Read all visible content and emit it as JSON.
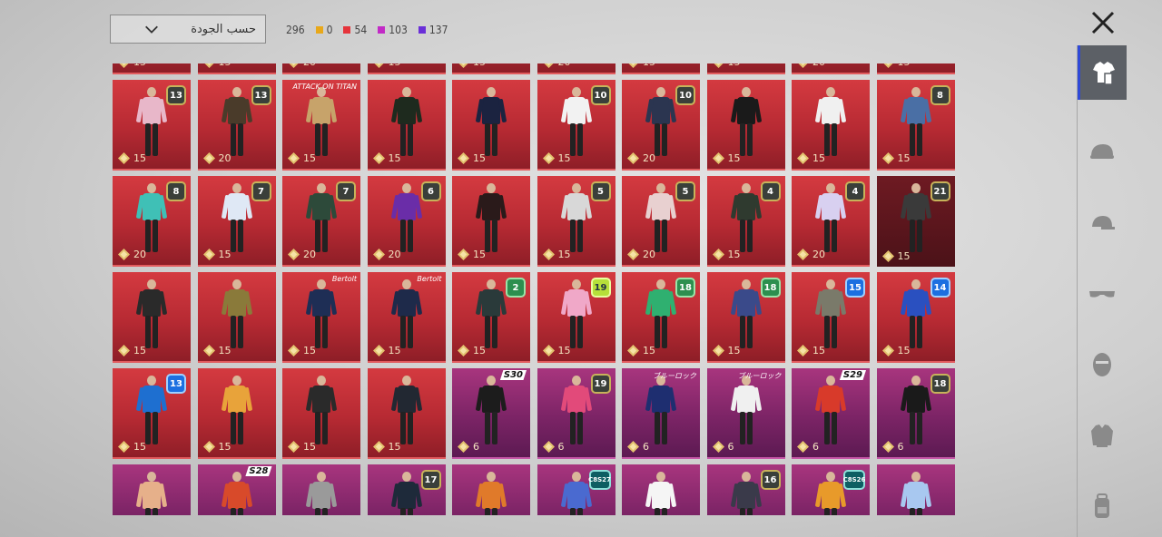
{
  "sort": {
    "label": "حسب الجودة"
  },
  "counts": {
    "total": "296",
    "items": [
      {
        "value": "0",
        "color": "#e8a81a"
      },
      {
        "value": "54",
        "color": "#e5343b"
      },
      {
        "value": "103",
        "color": "#c22ac6"
      },
      {
        "value": "137",
        "color": "#6a2fd8"
      }
    ]
  },
  "sidebar": {
    "items": [
      {
        "name": "outfit",
        "icon": "outfit-icon",
        "active": true
      },
      {
        "name": "helmet",
        "icon": "helmet-icon"
      },
      {
        "name": "hat",
        "icon": "cap-icon"
      },
      {
        "name": "glasses",
        "icon": "glasses-icon"
      },
      {
        "name": "mask",
        "icon": "mask-icon"
      },
      {
        "name": "jacket",
        "icon": "jacket-icon"
      },
      {
        "name": "backpack",
        "icon": "backpack-icon"
      }
    ]
  },
  "cards": [
    {
      "style": "red",
      "price": "15"
    },
    {
      "style": "red",
      "price": "15"
    },
    {
      "style": "red",
      "price": "20"
    },
    {
      "style": "red",
      "price": "15"
    },
    {
      "style": "red",
      "price": "15"
    },
    {
      "style": "red",
      "price": "20"
    },
    {
      "style": "red",
      "price": "15"
    },
    {
      "style": "red",
      "price": "15"
    },
    {
      "style": "red",
      "price": "20"
    },
    {
      "style": "red",
      "price": "15"
    },
    {
      "style": "red",
      "price": "15",
      "badge": "13",
      "fig": "#e8b7c9"
    },
    {
      "style": "red",
      "price": "20",
      "badge": "13",
      "fig": "#4a3b2a"
    },
    {
      "style": "red",
      "price": "15",
      "fig": "#c7a36a",
      "tag": "ATTACK ON TITAN"
    },
    {
      "style": "red",
      "price": "15",
      "fig": "#1e2a1e"
    },
    {
      "style": "red",
      "price": "15",
      "fig": "#1b2340"
    },
    {
      "style": "red",
      "price": "15",
      "badge": "10",
      "fig": "#f2f2f2"
    },
    {
      "style": "red",
      "price": "20",
      "badge": "10",
      "fig": "#2b3550"
    },
    {
      "style": "red",
      "price": "15",
      "fig": "#1a1a1a"
    },
    {
      "style": "red",
      "price": "15",
      "fig": "#f0f0f0"
    },
    {
      "style": "red",
      "price": "15",
      "badge": "8",
      "fig": "#4a6fa5"
    },
    {
      "style": "red",
      "price": "20",
      "badge": "8",
      "fig": "#3fc0b6"
    },
    {
      "style": "red",
      "price": "15",
      "badge": "7",
      "fig": "#dfe8f5"
    },
    {
      "style": "red",
      "price": "20",
      "badge": "7",
      "fig": "#2d4a3a"
    },
    {
      "style": "red",
      "price": "20",
      "badge": "6",
      "fig": "#6a2da8"
    },
    {
      "style": "red",
      "price": "15",
      "fig": "#2a1a1a"
    },
    {
      "style": "red",
      "price": "15",
      "badge": "5",
      "fig": "#d8d8d8"
    },
    {
      "style": "red",
      "price": "20",
      "badge": "5",
      "fig": "#e8d0d0"
    },
    {
      "style": "red",
      "price": "15",
      "badge": "4",
      "fig": "#2f3a2f"
    },
    {
      "style": "red",
      "price": "20",
      "badge": "4",
      "fig": "#d8d0f0"
    },
    {
      "style": "dark",
      "price": "15",
      "badge": "21",
      "fig": "#3a3a3a"
    },
    {
      "style": "red",
      "price": "15",
      "fig": "#2a2a2a"
    },
    {
      "style": "red",
      "price": "15",
      "fig": "#8a7a3a"
    },
    {
      "style": "red",
      "price": "15",
      "fig": "#1e2e55",
      "tag": "Bertolt"
    },
    {
      "style": "red",
      "price": "15",
      "fig": "#1e2a4a",
      "tag": "Bertolt"
    },
    {
      "style": "red",
      "price": "15",
      "badge": "2",
      "badgeStyle": "green",
      "fig": "#2a3a3a"
    },
    {
      "style": "red",
      "price": "15",
      "badge": "19",
      "badgeStyle": "lime",
      "fig": "#f0a8c8"
    },
    {
      "style": "red",
      "price": "15",
      "badge": "18",
      "badgeStyle": "green",
      "fig": "#2fb070"
    },
    {
      "style": "red",
      "price": "15",
      "badge": "18",
      "badgeStyle": "green",
      "fig": "#3a4a8a"
    },
    {
      "style": "red",
      "price": "15",
      "badge": "15",
      "badgeStyle": "blue",
      "fig": "#7a7a6a"
    },
    {
      "style": "red",
      "price": "15",
      "badge": "14",
      "badgeStyle": "blue",
      "fig": "#2a50c0"
    },
    {
      "style": "red",
      "price": "15",
      "badge": "13",
      "badgeStyle": "blue",
      "fig": "#1e6fd0"
    },
    {
      "style": "red",
      "price": "15",
      "fig": "#e8a33a"
    },
    {
      "style": "red",
      "price": "15",
      "fig": "#2a2a2a"
    },
    {
      "style": "red",
      "price": "15",
      "fig": "#222832"
    },
    {
      "style": "purple",
      "price": "6",
      "season": "S30",
      "fig": "#1c1c1c"
    },
    {
      "style": "purple",
      "price": "6",
      "badge": "19",
      "fig": "#e24a7a"
    },
    {
      "style": "purple",
      "price": "6",
      "tag": "ブルーロック",
      "fig": "#1e2e70"
    },
    {
      "style": "purple",
      "price": "6",
      "tag": "ブルーロック",
      "fig": "#f0f0f0"
    },
    {
      "style": "purple",
      "price": "6",
      "season": "S29",
      "fig": "#d83a2a"
    },
    {
      "style": "purple",
      "price": "6",
      "badge": "18",
      "fig": "#1a1a1a"
    },
    {
      "style": "purple",
      "price": "",
      "fig": "#e6b08a"
    },
    {
      "style": "purple",
      "price": "",
      "season": "S28",
      "fig": "#d84a2a"
    },
    {
      "style": "purple",
      "price": "",
      "fig": "#9a9a9a"
    },
    {
      "style": "purple",
      "price": "",
      "badge": "17",
      "fig": "#1e2a3a"
    },
    {
      "style": "purple",
      "price": "",
      "fig": "#e07a2a"
    },
    {
      "style": "purple",
      "price": "",
      "badge": "C8S27",
      "badgeStyle": "teal",
      "fig": "#4a6ad0"
    },
    {
      "style": "purple",
      "price": "",
      "fig": "#f5f5f5"
    },
    {
      "style": "purple",
      "price": "",
      "badge": "16",
      "fig": "#3a3a4a"
    },
    {
      "style": "purple",
      "price": "",
      "badge": "C8S26",
      "badgeStyle": "teal",
      "fig": "#e89a2a"
    },
    {
      "style": "purple",
      "price": "",
      "fig": "#a8c8f0"
    }
  ]
}
